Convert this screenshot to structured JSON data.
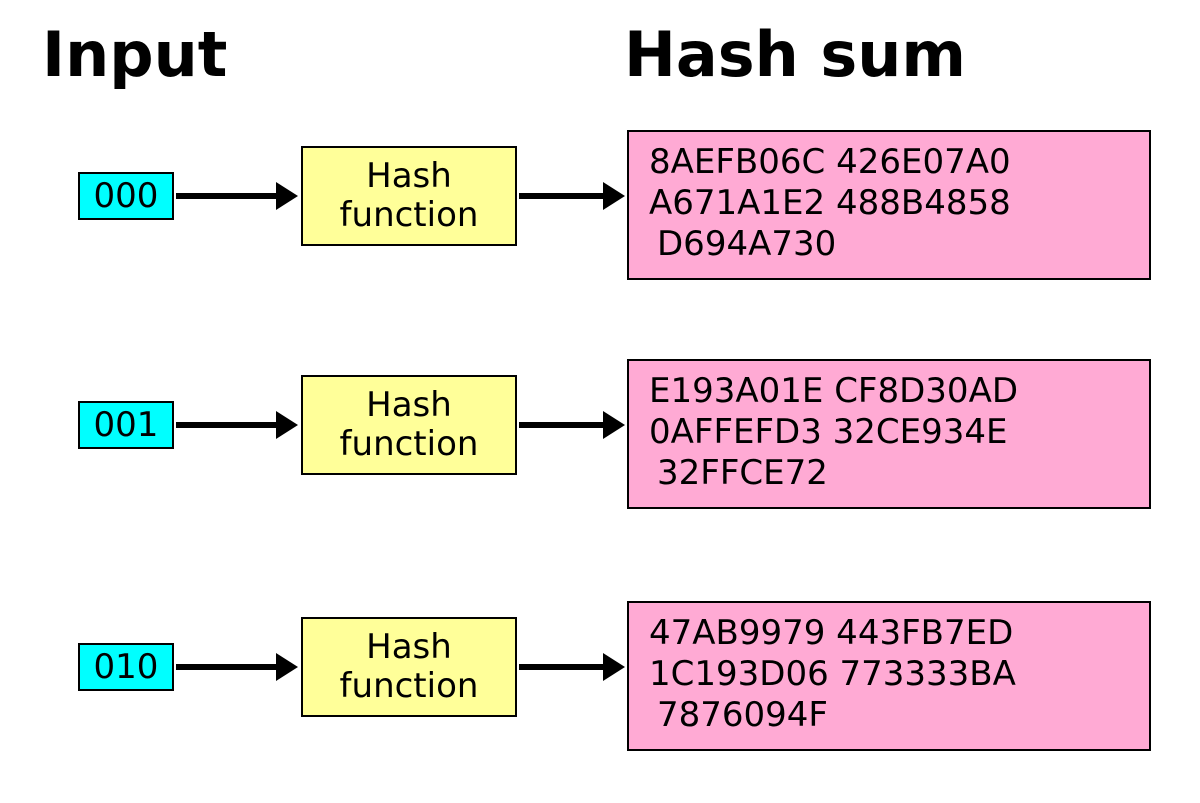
{
  "headings": {
    "input": "Input",
    "output": "Hash sum"
  },
  "rows": [
    {
      "input": "000",
      "function_label": "Hash function",
      "hash_lines": [
        "8AEFB06C 426E07A0",
        "A671A1E2 488B4858",
        "D694A730"
      ]
    },
    {
      "input": "001",
      "function_label": "Hash function",
      "hash_lines": [
        "E193A01E CF8D30AD",
        "0AFFEFD3 32CE934E",
        "32FFCE72"
      ]
    },
    {
      "input": "010",
      "function_label": "Hash function",
      "hash_lines": [
        "47AB9979 443FB7ED",
        "1C193D06 773333BA",
        "7876094F"
      ]
    }
  ],
  "colors": {
    "input_box": "#00ffff",
    "function_box": "#ffff99",
    "hash_box": "#ffaad4"
  }
}
